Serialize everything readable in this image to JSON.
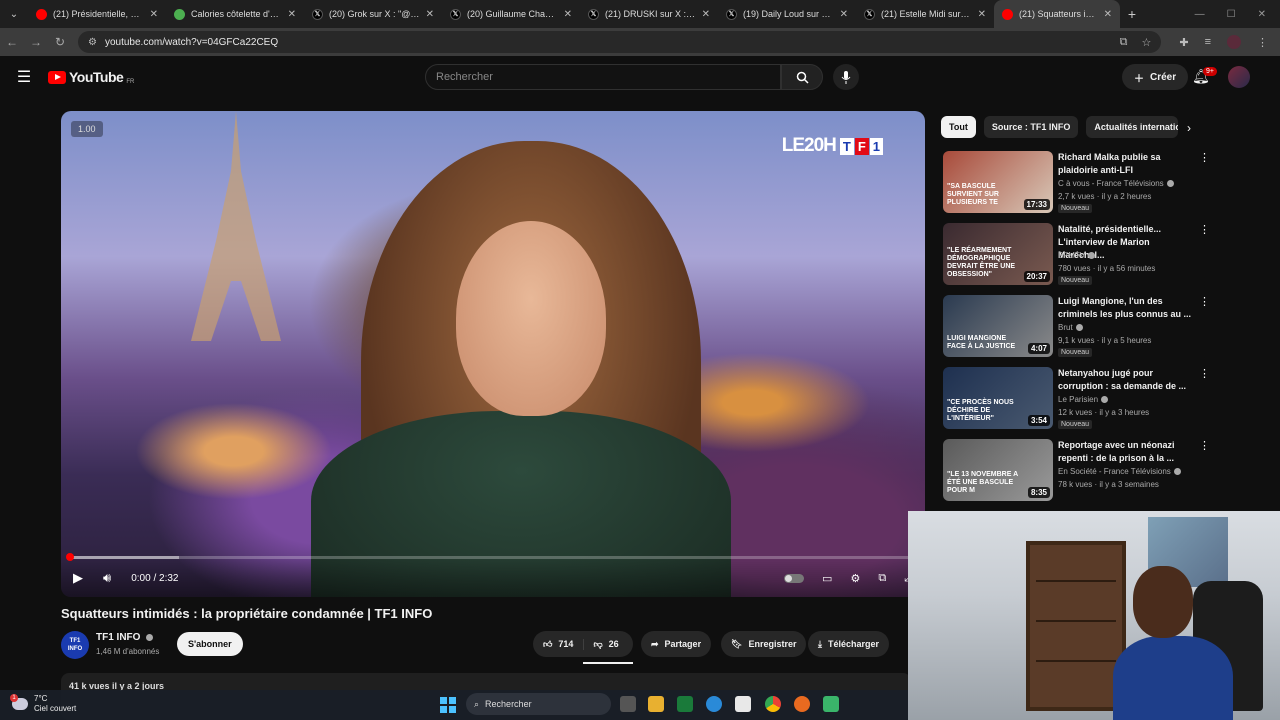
{
  "browser": {
    "tabs": [
      {
        "title": "(21) Présidentielle, budge",
        "fav": "yt",
        "color": "#ff0000"
      },
      {
        "title": "Calories côtelette d'agneau",
        "fav": "calc",
        "color": "#4caf50"
      },
      {
        "title": "(20) Grok sur X : \"@raphae",
        "fav": "x",
        "color": "#000000"
      },
      {
        "title": "(20) Guillaume Champeau",
        "fav": "x",
        "color": "#000000"
      },
      {
        "title": "(21) DRUSKI sur X : \"Dude",
        "fav": "x",
        "color": "#000000"
      },
      {
        "title": "(19) Daily Loud sur X : \"2",
        "fav": "x",
        "color": "#000000"
      },
      {
        "title": "(21) Estelle Midi sur X : \"",
        "fav": "x",
        "color": "#000000"
      },
      {
        "title": "(21) Squatteurs intimidés",
        "fav": "yt",
        "color": "#ff0000",
        "active": true
      }
    ],
    "new_tab": "+",
    "url": "youtube.com/watch?v=04GFCa22CEQ"
  },
  "youtube": {
    "logo_text": "YouTube",
    "country": "FR",
    "search_placeholder": "Rechercher",
    "create_label": "Créer",
    "notifications_badge": "9+"
  },
  "player": {
    "speed_badge": "1.00",
    "channel_bug": "LE20H",
    "tf1_letters": [
      "T",
      "F",
      "1"
    ],
    "timecode": "0:00 / 2:32",
    "buffer_fraction": 0.13,
    "played_fraction": 0.0
  },
  "video": {
    "title": "Squatteurs intimidés : la propriétaire condamnée | TF1 INFO",
    "channel_name": "TF1 INFO",
    "channel_avatar_lines": [
      "TF1",
      "INFO"
    ],
    "subscribers": "1,46 M d'abonnés",
    "subscribe_label": "S'abonner",
    "likes": "714",
    "dislikes": "26",
    "share_label": "Partager",
    "save_label": "Enregistrer",
    "download_label": "Télécharger",
    "description_preview": "41 k vues  il y a 2 jours"
  },
  "sidebar": {
    "chips": [
      "Tout",
      "Source : TF1 INFO",
      "Actualités internatio"
    ],
    "recommendations": [
      {
        "title": "Richard Malka publie sa plaidoirie anti-LFI",
        "channel": "C à vous - France Télévisions",
        "meta": "2,7 k vues · il y a 2 heures",
        "duration": "17:33",
        "badge": "Nouveau",
        "thumb_caption": "\"SA BASCULE SURVIENT SUR PLUSIEURS TE",
        "thumb_colors": [
          "#a84a3a",
          "#d8c8b8"
        ]
      },
      {
        "title": "Natalité, présidentielle... L'interview de Marion Maréchal...",
        "channel": "BFMTV",
        "meta": "780 vues · il y a 56 minutes",
        "duration": "20:37",
        "badge": "Nouveau",
        "thumb_caption": "\"Le réarmement démographique devrait être une obsession\"",
        "thumb_colors": [
          "#3a2a30",
          "#7a5a50"
        ]
      },
      {
        "title": "Luigi Mangione, l'un des criminels les plus connus au ...",
        "channel": "Brut",
        "meta": "9,1 k vues · il y a 5 heures",
        "duration": "4:07",
        "badge": "Nouveau",
        "thumb_caption": "Luigi Mangione face à la justice",
        "thumb_colors": [
          "#2a3a50",
          "#8a8a8a"
        ]
      },
      {
        "title": "Netanyahou jugé pour corruption : sa demande de ...",
        "channel": "Le Parisien",
        "meta": "12 k vues · il y a 3 heures",
        "duration": "3:54",
        "badge": "Nouveau",
        "thumb_caption": "\"Ce procès nous déchire de l'intérieur\"",
        "thumb_colors": [
          "#1e3050",
          "#4a5a70"
        ]
      },
      {
        "title": "Reportage avec un néonazi repenti : de la prison à la ...",
        "channel": "En Société - France Télévisions",
        "meta": "78 k vues · il y a 3 semaines",
        "duration": "8:35",
        "badge": "",
        "thumb_caption": "\"LE 13 NOVEMBRE A ÉTÉ UNE BASCULE POUR M",
        "thumb_colors": [
          "#5a5a5a",
          "#9a9a9a"
        ]
      }
    ]
  },
  "taskbar": {
    "temperature": "7°C",
    "weather": "Ciel couvert",
    "search_label": "Rechercher"
  }
}
